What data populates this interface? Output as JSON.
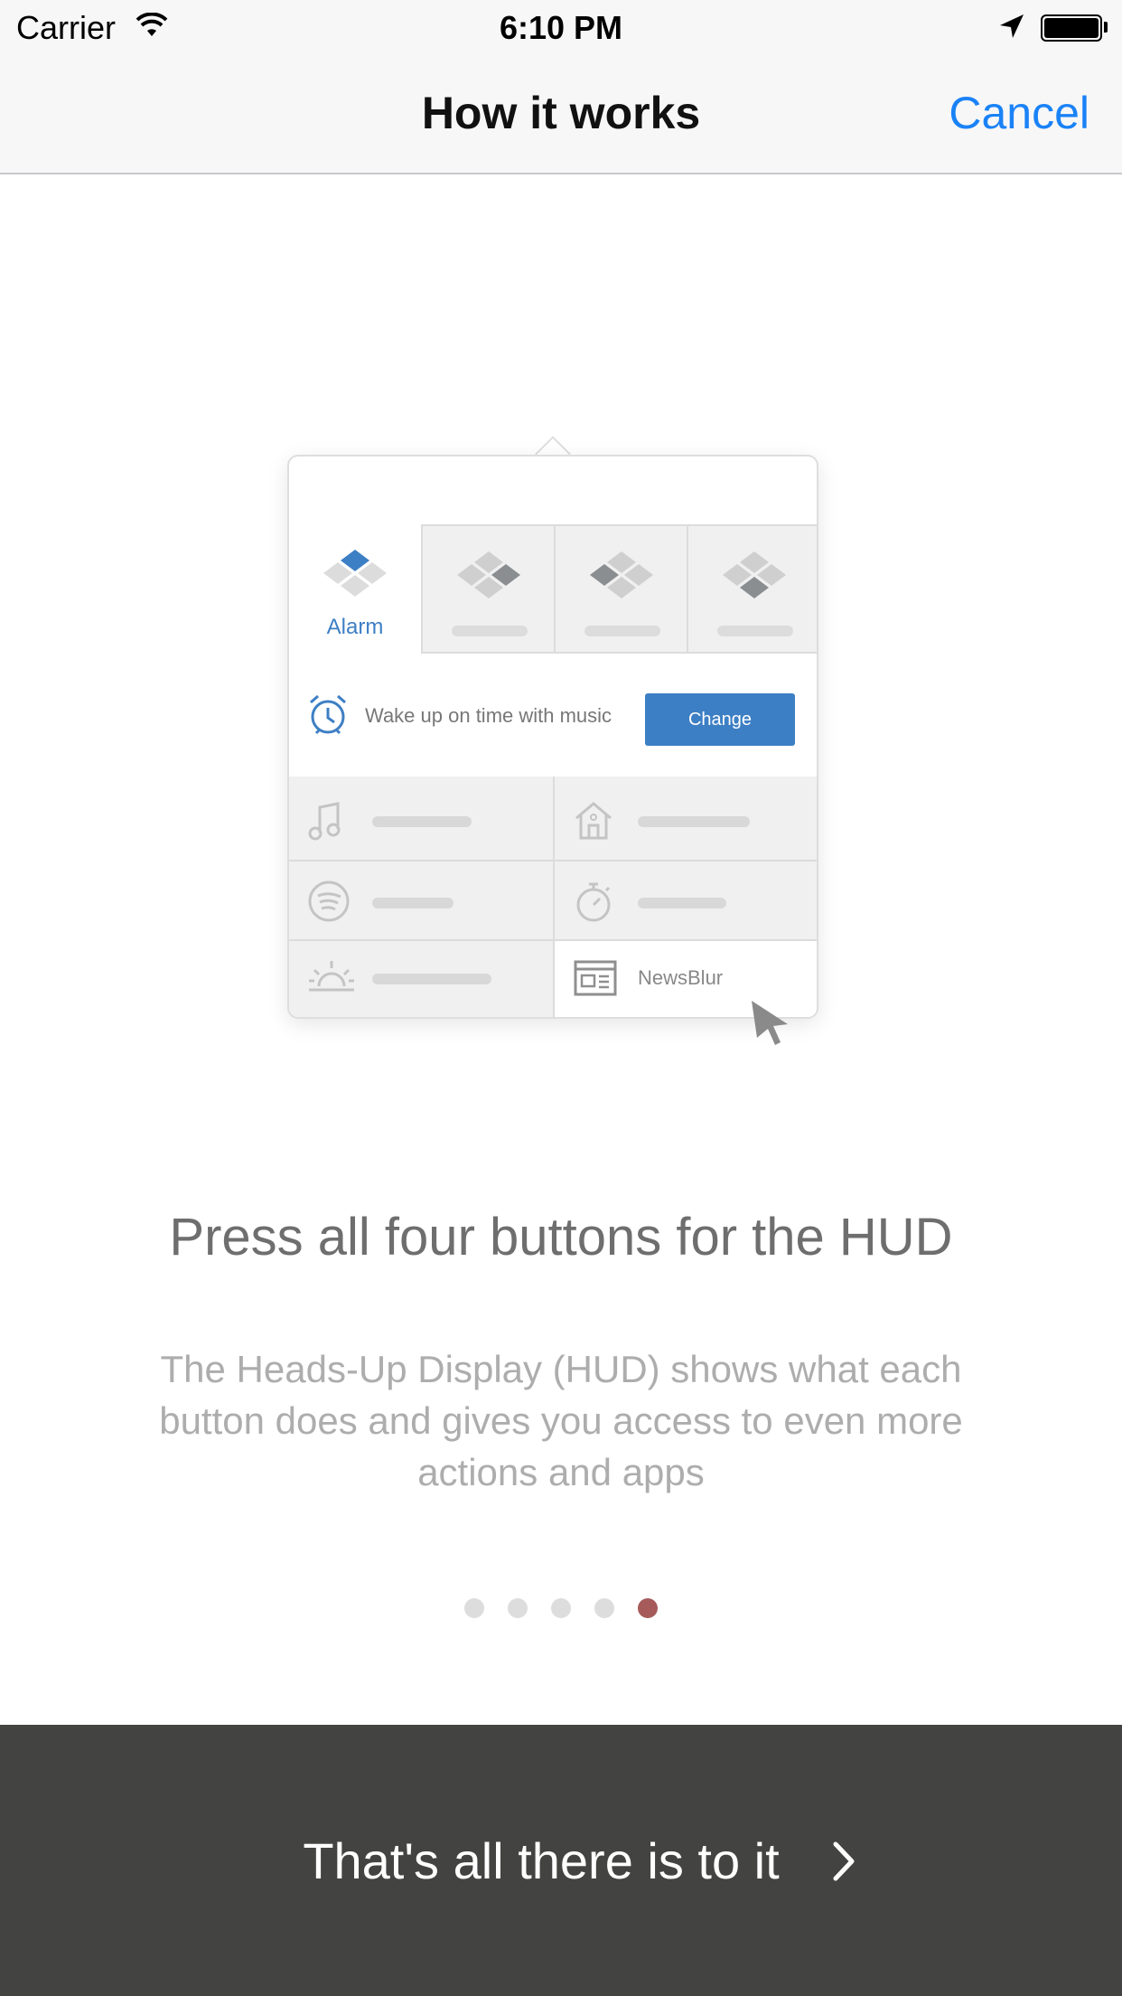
{
  "status_bar": {
    "carrier": "Carrier",
    "time": "6:10 PM",
    "icons": [
      "wifi-icon",
      "location-arrow-icon",
      "battery-icon"
    ]
  },
  "nav": {
    "title": "How it works",
    "cancel_label": "Cancel"
  },
  "illustration": {
    "active_tab_label": "Alarm",
    "alarm_text": "Wake up on time with music",
    "change_label": "Change",
    "newsblur_label": "NewsBlur",
    "icons": [
      "music-note-icon",
      "house-icon",
      "spotify-icon",
      "stopwatch-icon",
      "sunrise-icon",
      "newspaper-icon",
      "alarm-clock-icon",
      "cursor-icon"
    ]
  },
  "content": {
    "headline": "Press all four buttons for the HUD",
    "body": "The Heads-Up Display (HUD) shows what each button does and gives you access to even more actions and apps"
  },
  "pager": {
    "total": 5,
    "active_index": 4
  },
  "footer": {
    "label": "That's all there is to it"
  },
  "colors": {
    "accent_blue": "#1a82f7",
    "hud_blue": "#3d7fc4",
    "footer_bg": "#434341",
    "active_dot": "#a65a5a"
  }
}
